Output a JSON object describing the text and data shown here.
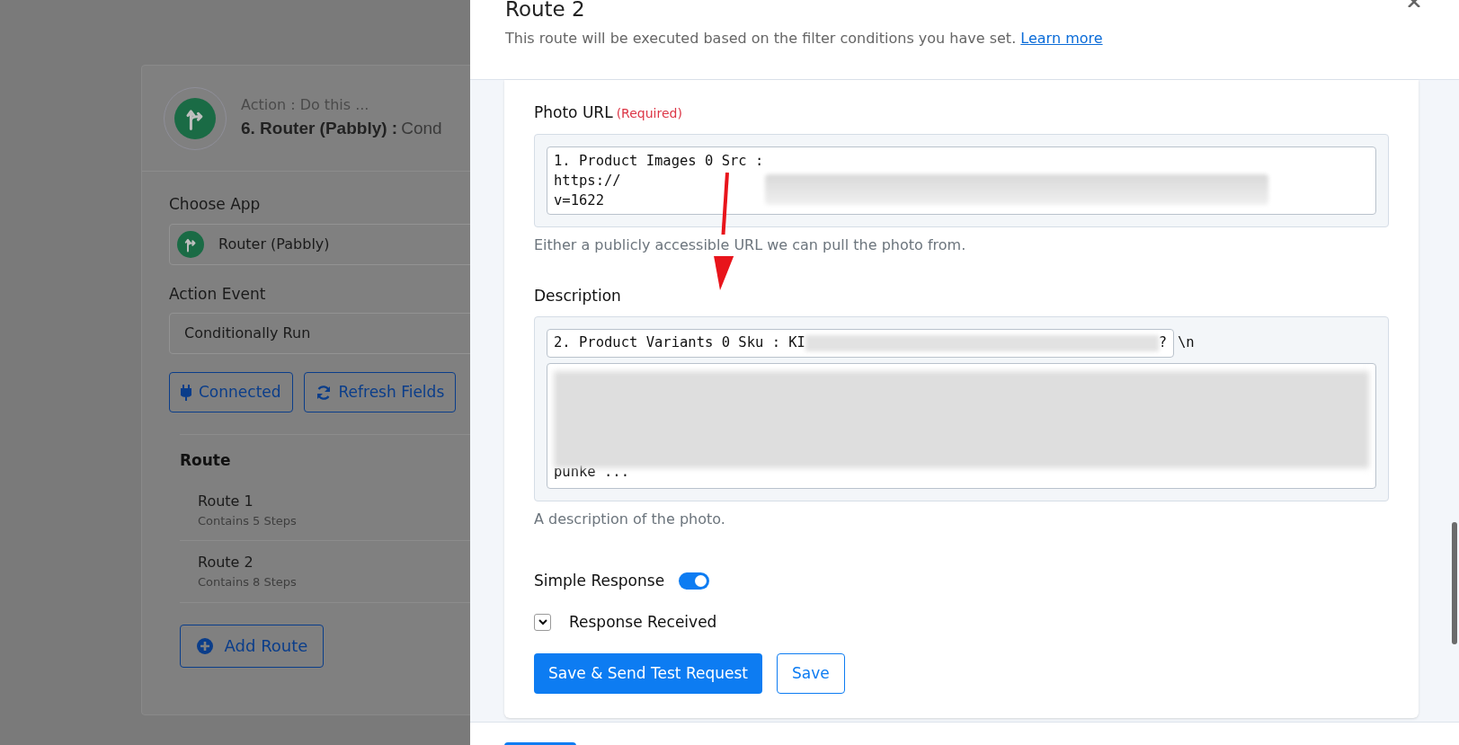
{
  "background_card": {
    "action_label": "Action : Do this ...",
    "step_title": "6. Router (Pabbly) :",
    "step_event": "Cond",
    "choose_app": {
      "label": "Choose App",
      "value": "Router (Pabbly)"
    },
    "action_event": {
      "label": "Action Event",
      "value": "Conditionally Run"
    },
    "buttons": [
      {
        "kind": "connected",
        "label": "Connected"
      },
      {
        "kind": "refresh",
        "label": "Refresh Fields"
      }
    ],
    "route_heading": "Route",
    "routes": [
      {
        "name": "Route 1",
        "steps": "Contains 5 Steps"
      },
      {
        "name": "Route 2",
        "steps": "Contains 8 Steps"
      }
    ],
    "add_route": "Add Route"
  },
  "drawer": {
    "title": "Route 2",
    "subtitle": "This route will be executed based on the filter conditions you have set.",
    "link": "Learn more",
    "photo_url": {
      "label": "Photo URL",
      "required": "(Required)",
      "lines": [
        "1. Product Images 0 Src :",
        "https://",
        "v=1622"
      ],
      "help": "Either a publicly accessible URL we can pull the photo from."
    },
    "description": {
      "label": "Description",
      "token": "2. Product Variants 0 Sku : KI",
      "token_end": "?",
      "newline": "\\n",
      "text_tail": "punke ...",
      "help": "A description of the photo."
    },
    "simple_response": {
      "label": "Simple Response",
      "on": true
    },
    "response_received": {
      "label": "Response Received",
      "expanded": false
    },
    "primary_button": "Save & Send Test Request",
    "secondary_button": "Save"
  }
}
